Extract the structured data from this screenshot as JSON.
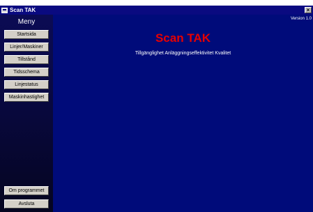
{
  "window": {
    "title": "Scan TAK",
    "close_glyph": "×"
  },
  "sidebar": {
    "title": "Meny",
    "items": [
      {
        "label": "Startsida"
      },
      {
        "label": "Linjer/Maskiner"
      },
      {
        "label": "Tillstånd"
      },
      {
        "label": "Tidsschema"
      },
      {
        "label": "Linjestatus"
      },
      {
        "label": "Maskinhastighet"
      }
    ],
    "footer_items": [
      {
        "label": "Om programmet"
      },
      {
        "label": "Avsluta"
      }
    ]
  },
  "main": {
    "version": "Version 1.0",
    "title": "Scan TAK",
    "subtitle": "Tillgänglighet Anläggningseffektivitet Kvalitet"
  },
  "colors": {
    "background": "#000b7a",
    "title_red": "#e60000",
    "titlebar": "#0a0a80",
    "button_face": "#d4d0c8"
  },
  "icons": [
    "app-icon",
    "close-icon"
  ]
}
